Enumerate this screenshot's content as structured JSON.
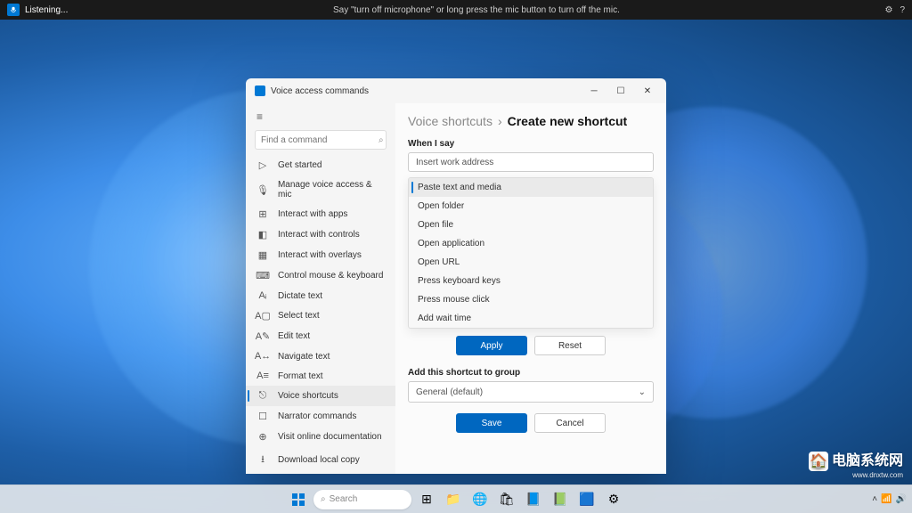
{
  "topbar": {
    "status": "Listening...",
    "hint": "Say \"turn off microphone\" or long press the mic button to turn off the mic."
  },
  "window": {
    "title": "Voice access commands",
    "search_placeholder": "Find a command",
    "nav": [
      {
        "icon": "▷",
        "label": "Get started"
      },
      {
        "icon": "🎙",
        "label": "Manage voice access & mic"
      },
      {
        "icon": "⊞",
        "label": "Interact with apps"
      },
      {
        "icon": "◧",
        "label": "Interact with controls"
      },
      {
        "icon": "▦",
        "label": "Interact with overlays"
      },
      {
        "icon": "⌨",
        "label": "Control mouse & keyboard"
      },
      {
        "icon": "Aᵢ",
        "label": "Dictate text"
      },
      {
        "icon": "A▢",
        "label": "Select text"
      },
      {
        "icon": "A✎",
        "label": "Edit text"
      },
      {
        "icon": "A↔",
        "label": "Navigate text"
      },
      {
        "icon": "A≡",
        "label": "Format text"
      },
      {
        "icon": "⎋",
        "label": "Voice shortcuts",
        "selected": true
      },
      {
        "icon": "☐",
        "label": "Narrator commands"
      },
      {
        "icon": "⊕",
        "label": "Visit online documentation"
      },
      {
        "icon": "⭳",
        "label": "Download local copy"
      }
    ],
    "breadcrumb": {
      "parent": "Voice shortcuts",
      "current": "Create new shortcut"
    },
    "form": {
      "when_label": "When I say",
      "when_value": "Insert work address",
      "actions": [
        {
          "label": "Paste text and media",
          "selected": true
        },
        {
          "label": "Open folder"
        },
        {
          "label": "Open file"
        },
        {
          "label": "Open application"
        },
        {
          "label": "Open URL"
        },
        {
          "label": "Press keyboard keys"
        },
        {
          "label": "Press mouse click"
        },
        {
          "label": "Add wait time"
        }
      ],
      "apply": "Apply",
      "reset": "Reset",
      "group_label": "Add this shortcut to group",
      "group_value": "General (default)",
      "save": "Save",
      "cancel": "Cancel"
    }
  },
  "taskbar": {
    "search": "Search"
  },
  "watermark": {
    "text": "电脑系统网",
    "sub": "www.dnxtw.com"
  }
}
